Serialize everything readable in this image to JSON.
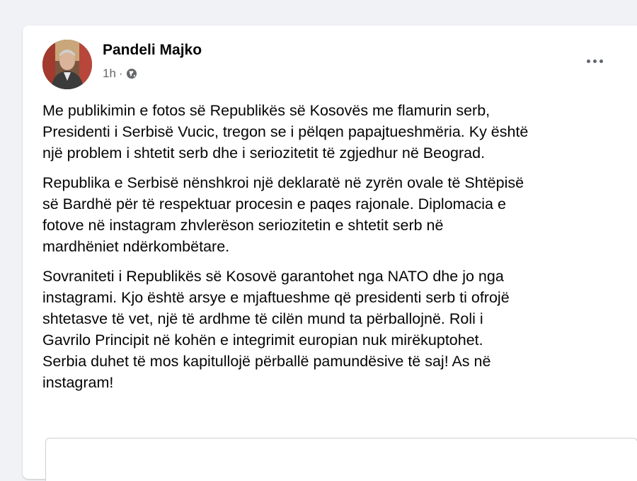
{
  "post": {
    "author": "Pandeli Majko",
    "timestamp": "1h",
    "separator": "·",
    "privacy_icon": "globe-icon",
    "menu_icon": "more-horizontal-icon",
    "paragraphs": [
      "Me publikimin e fotos së Republikës së Kosovës me flamurin serb,\nPresidenti i Serbisë Vucic, tregon se i pëlqen papajtueshmëria. Ky është\nnjë problem i shtetit serb dhe i seriozitetit të zgjedhur në Beograd.",
      "Republika e Serbisë nënshkroi një deklaratë në zyrën ovale të Shtëpisë\nsë Bardhë për të respektuar procesin e paqes rajonale. Diplomacia e\nfotove në instagram zhvlerëson seriozitetin e shtetit serb në\nmardhëniet ndërkombëtare.",
      "Sovraniteti i Republikës së Kosovë garantohet nga NATO dhe jo nga\ninstagrami. Kjo është arsye e mjaftueshme që presidenti serb ti ofrojë\nshtetasve të vet, një të ardhme të cilën mund ta përballojnë. Roli i\nGavrilo Principit në kohën e integrimit europian nuk mirëkuptohet.\nSerbia duhet të mos kapitullojë përballë pamundësive të saj! As në\ninstagram!"
    ]
  },
  "colors": {
    "background": "#f0f2f5",
    "card": "#ffffff",
    "text_primary": "#050505",
    "text_secondary": "#65676b"
  }
}
